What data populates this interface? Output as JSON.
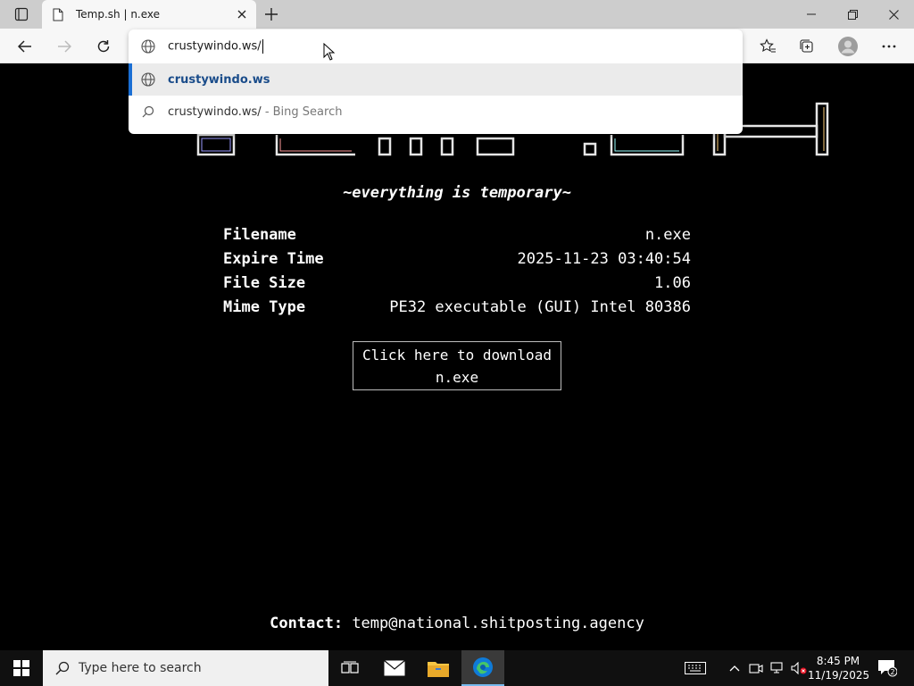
{
  "browser": {
    "tab_title": "Temp.sh | n.exe",
    "address_text": "crustywindo.ws/",
    "suggestions": [
      {
        "text": "crustywindo.ws",
        "hint": ""
      },
      {
        "text": "crustywindo.ws/",
        "hint": " - Bing Search"
      }
    ]
  },
  "page": {
    "banner": "TEMP.SH",
    "tagline": "~everything is temporary~",
    "info": [
      {
        "label": "Filename",
        "value": "n.exe"
      },
      {
        "label": "Expire Time",
        "value": "2025-11-23 03:40:54"
      },
      {
        "label": "File Size",
        "value": "1.06"
      },
      {
        "label": "Mime Type",
        "value": "PE32 executable (GUI) Intel 80386"
      }
    ],
    "download_line1": "Click here to download",
    "download_line2": "n.exe",
    "contact_label": "Contact:",
    "contact_email": "temp@national.shitposting.agency"
  },
  "taskbar": {
    "search_placeholder": "Type here to search",
    "time": "8:45 PM",
    "date": "11/19/2025",
    "notifications": "2"
  },
  "colors": {
    "accent": "#1a6fd4",
    "edge_blue": "#0f7bd8",
    "folder_yellow": "#f6c544"
  }
}
